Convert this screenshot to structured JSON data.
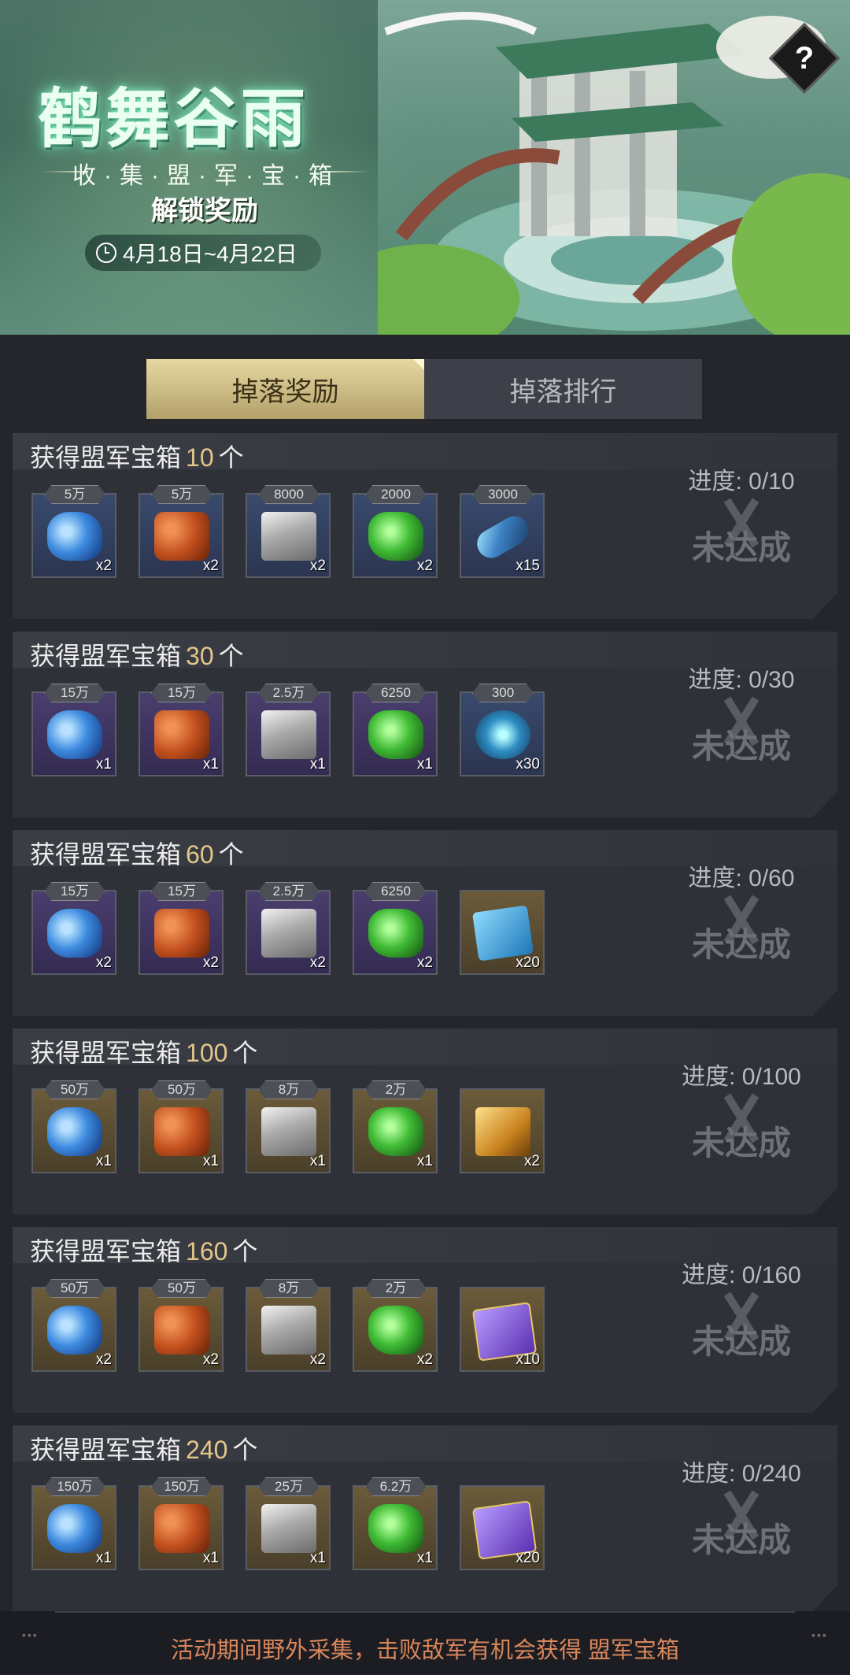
{
  "banner": {
    "title": "鹤舞谷雨",
    "subtitle": "收·集·盟·军·宝·箱",
    "unlock": "解锁奖励",
    "date": "4月18日~4月22日",
    "help": "?"
  },
  "tabs": [
    {
      "label": "掉落奖励",
      "active": true
    },
    {
      "label": "掉落排行",
      "active": false
    }
  ],
  "tiers": [
    {
      "prefix": "获得盟军宝箱",
      "count": "10",
      "suffix": "个",
      "progress": "进度: 0/10",
      "status": "未达成",
      "items": [
        {
          "icon": "crystal-icon",
          "tag": "5万",
          "qty": "x2"
        },
        {
          "icon": "oil-barrel-icon",
          "tag": "5万",
          "qty": "x2"
        },
        {
          "icon": "steel-icon",
          "tag": "8000",
          "qty": "x2"
        },
        {
          "icon": "gem-icon",
          "tag": "2000",
          "qty": "x2"
        },
        {
          "icon": "cylinder-icon",
          "tag": "3000",
          "qty": "x15"
        }
      ]
    },
    {
      "prefix": "获得盟军宝箱",
      "count": "30",
      "suffix": "个",
      "progress": "进度: 0/30",
      "status": "未达成",
      "items": [
        {
          "icon": "crystal-icon",
          "tag": "15万",
          "qty": "x1"
        },
        {
          "icon": "oil-barrel-icon",
          "tag": "15万",
          "qty": "x1"
        },
        {
          "icon": "steel-icon",
          "tag": "2.5万",
          "qty": "x1"
        },
        {
          "icon": "gem-icon",
          "tag": "6250",
          "qty": "x1"
        },
        {
          "icon": "device-icon",
          "tag": "300",
          "qty": "x30"
        }
      ]
    },
    {
      "prefix": "获得盟军宝箱",
      "count": "60",
      "suffix": "个",
      "progress": "进度: 0/60",
      "status": "未达成",
      "items": [
        {
          "icon": "crystal-icon",
          "tag": "15万",
          "qty": "x2"
        },
        {
          "icon": "oil-barrel-icon",
          "tag": "15万",
          "qty": "x2"
        },
        {
          "icon": "steel-icon",
          "tag": "2.5万",
          "qty": "x2"
        },
        {
          "icon": "gem-icon",
          "tag": "6250",
          "qty": "x2"
        },
        {
          "icon": "blue-card-icon",
          "tag": "",
          "qty": "x20"
        }
      ]
    },
    {
      "prefix": "获得盟军宝箱",
      "count": "100",
      "suffix": "个",
      "progress": "进度: 0/100",
      "status": "未达成",
      "items": [
        {
          "icon": "crystal-icon",
          "tag": "50万",
          "qty": "x1"
        },
        {
          "icon": "oil-barrel-icon",
          "tag": "50万",
          "qty": "x1"
        },
        {
          "icon": "steel-icon",
          "tag": "8万",
          "qty": "x1"
        },
        {
          "icon": "gem-icon",
          "tag": "2万",
          "qty": "x1"
        },
        {
          "icon": "factory-icon",
          "tag": "",
          "qty": "x2"
        }
      ]
    },
    {
      "prefix": "获得盟军宝箱",
      "count": "160",
      "suffix": "个",
      "progress": "进度: 0/160",
      "status": "未达成",
      "items": [
        {
          "icon": "crystal-icon",
          "tag": "50万",
          "qty": "x2"
        },
        {
          "icon": "oil-barrel-icon",
          "tag": "50万",
          "qty": "x2"
        },
        {
          "icon": "steel-icon",
          "tag": "8万",
          "qty": "x2"
        },
        {
          "icon": "gem-icon",
          "tag": "2万",
          "qty": "x2"
        },
        {
          "icon": "purple-card-icon",
          "tag": "",
          "qty": "x10"
        }
      ]
    },
    {
      "prefix": "获得盟军宝箱",
      "count": "240",
      "suffix": "个",
      "progress": "进度: 0/240",
      "status": "未达成",
      "items": [
        {
          "icon": "crystal-icon",
          "tag": "150万",
          "qty": "x1"
        },
        {
          "icon": "oil-barrel-icon",
          "tag": "150万",
          "qty": "x1"
        },
        {
          "icon": "steel-icon",
          "tag": "25万",
          "qty": "x1"
        },
        {
          "icon": "gem-icon",
          "tag": "6.2万",
          "qty": "x1"
        },
        {
          "icon": "purple-card-icon",
          "tag": "",
          "qty": "x20"
        }
      ]
    }
  ],
  "footer": {
    "text": "活动期间野外采集，击败敌军有机会获得 盟军宝箱"
  },
  "colors": {
    "accent_gold": "#e3c68a",
    "footer_text": "#d9865b",
    "background": "#24262c"
  }
}
